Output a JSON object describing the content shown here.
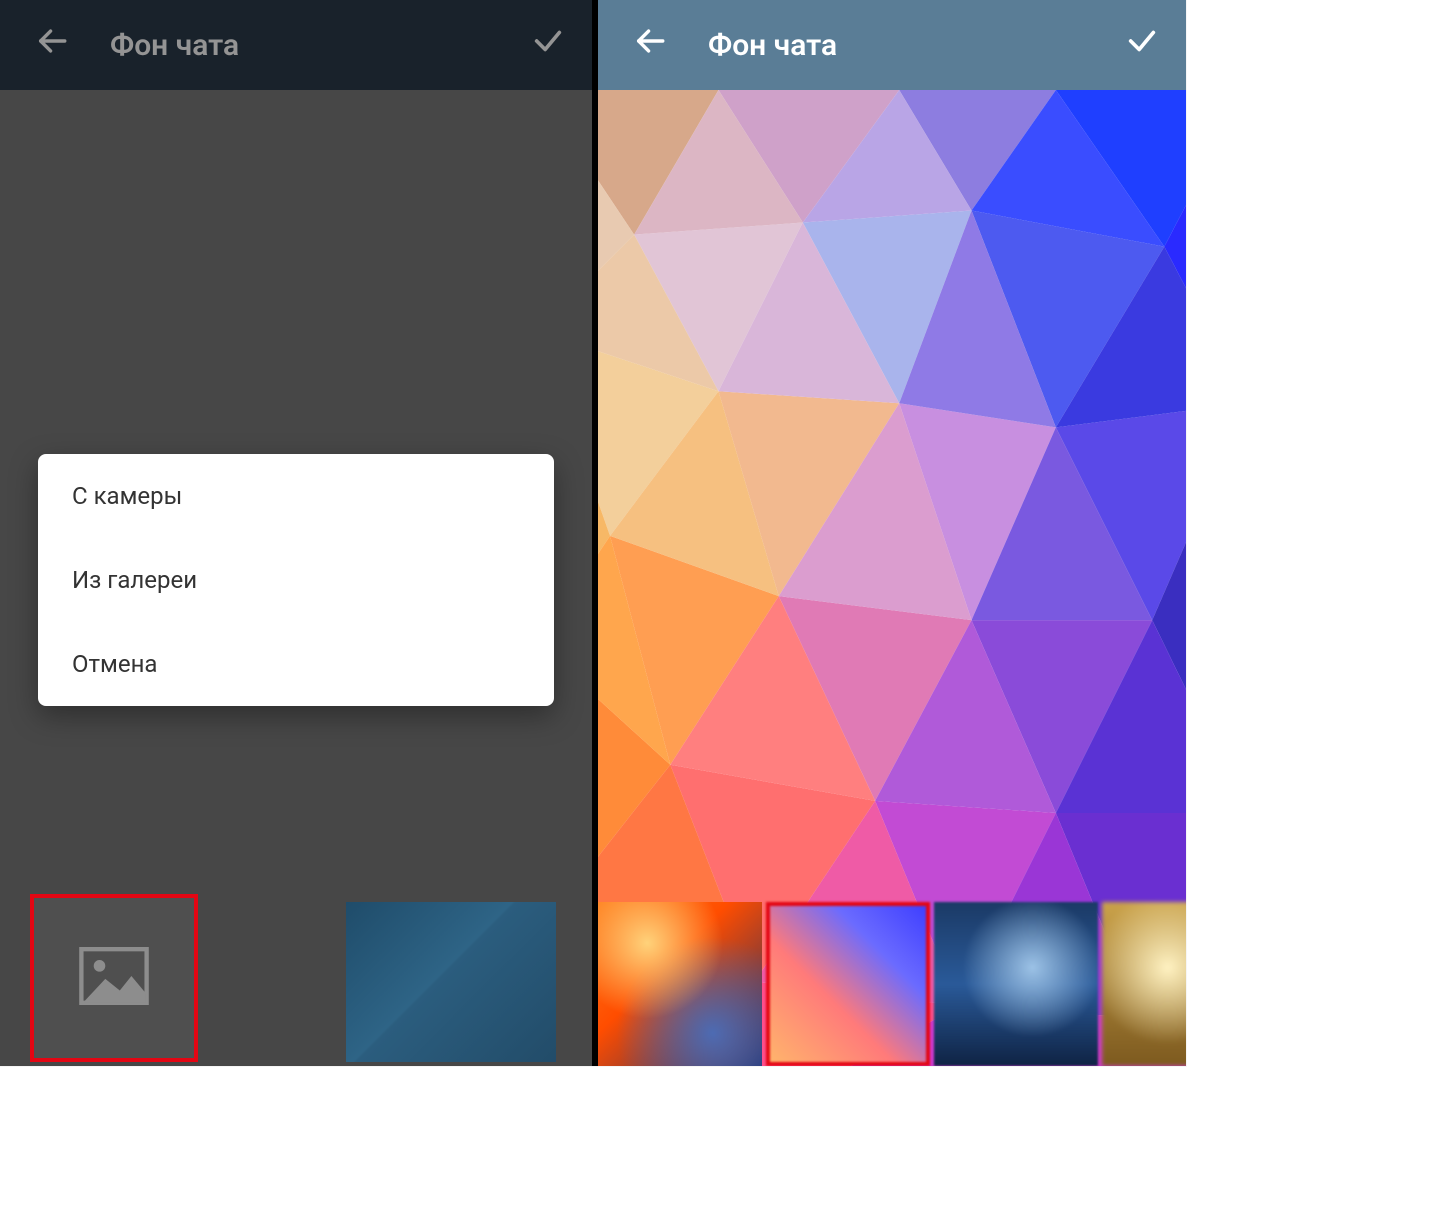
{
  "left": {
    "title": "Фон чата",
    "sheet": {
      "camera": "С камеры",
      "gallery": "Из галереи",
      "cancel": "Отмена"
    }
  },
  "right": {
    "title": "Фон чата"
  },
  "icons": {
    "back": "back-arrow-icon",
    "confirm": "check-icon",
    "upload": "image-placeholder-icon"
  }
}
